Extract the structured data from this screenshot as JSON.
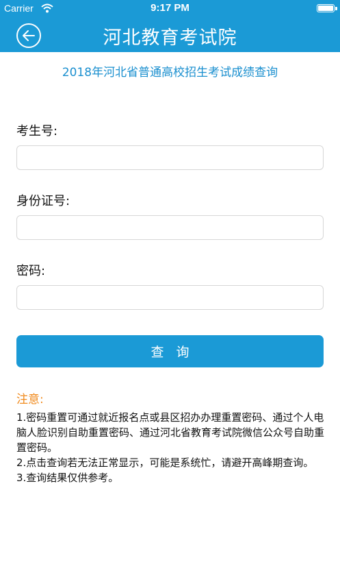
{
  "status_bar": {
    "carrier": "Carrier",
    "time": "9:17 PM",
    "battery_level": 1.0
  },
  "nav": {
    "title": "河北教育考试院",
    "back_icon": "back-arrow-circle-icon"
  },
  "subtitle": "2018年河北省普通高校招生考试成绩查询",
  "form": {
    "exam_number": {
      "label": "考生号:",
      "value": "",
      "placeholder": ""
    },
    "id_number": {
      "label": "身份证号:",
      "value": "",
      "placeholder": ""
    },
    "password": {
      "label": "密码:",
      "value": "",
      "placeholder": ""
    },
    "submit_label": "查询"
  },
  "notice": {
    "title": "注意:",
    "items": [
      "1.密码重置可通过就近报名点或县区招办办理重置密码、通过个人电脑人脸识别自助重置密码、通过河北省教育考试院微信公众号自助重置密码。",
      "2.点击查询若无法正常显示，可能是系统忙，请避开高峰期查询。",
      "3.查询结果仅供参考。"
    ]
  },
  "colors": {
    "primary": "#1b9ad6",
    "subtitle": "#1a8fcf",
    "notice_title": "#f08a1c"
  }
}
